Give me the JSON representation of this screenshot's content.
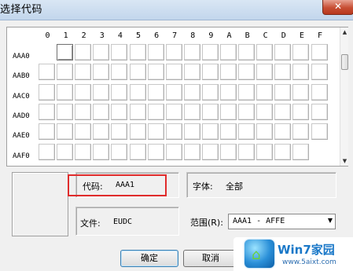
{
  "window": {
    "title": "选择代码",
    "close_label": "✕"
  },
  "grid": {
    "columns": [
      "0",
      "1",
      "2",
      "3",
      "4",
      "5",
      "6",
      "7",
      "8",
      "9",
      "A",
      "B",
      "C",
      "D",
      "E",
      "F"
    ],
    "rows": [
      "AAA0",
      "AAB0",
      "AAC0",
      "AAD0",
      "AAE0",
      "AAF0"
    ],
    "selected_code": "AAA1"
  },
  "scrollbar": {
    "up_icon": "▲",
    "down_icon": "▼"
  },
  "info": {
    "code_label": "代码:",
    "code_value": "AAA1",
    "font_label": "字体:",
    "font_value": "全部",
    "file_label": "文件:",
    "file_value": "EUDC",
    "range_label": "范围(R):",
    "range_value": "AAA1 - AFFE",
    "range_arrow": "▼"
  },
  "buttons": {
    "ok_label": "确定",
    "cancel_label": "取消"
  },
  "watermark": {
    "title": "Win7家园",
    "url": "www.5aixt.com"
  },
  "colors": {
    "highlight": "#e02c2c",
    "title_bar": "#c2d6ec",
    "dialog_bg": "#f0f0f0"
  }
}
